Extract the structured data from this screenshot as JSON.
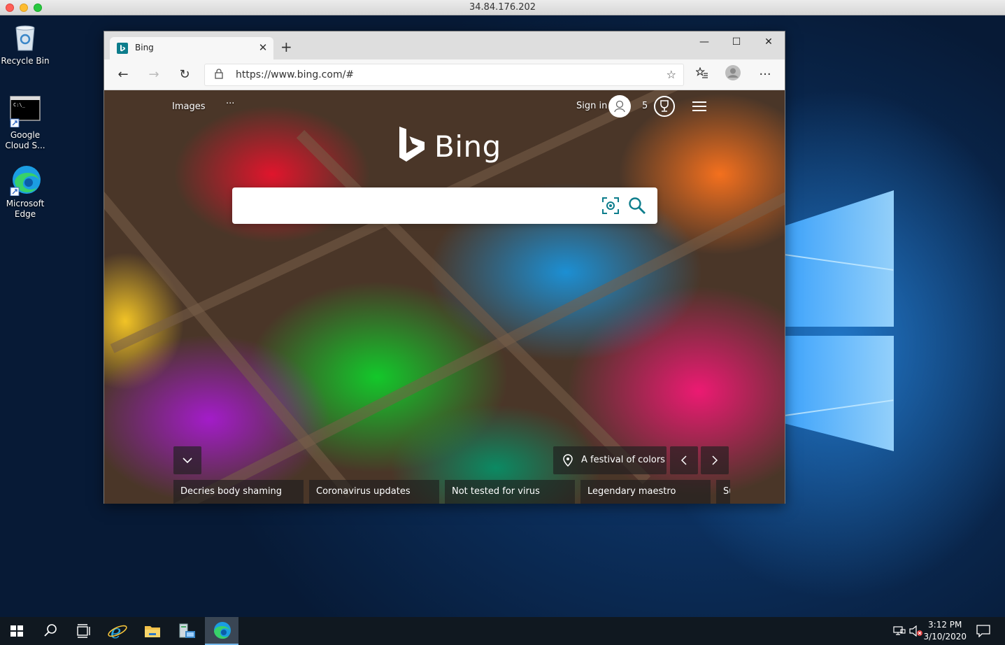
{
  "host": {
    "title": "34.84.176.202"
  },
  "desktop": {
    "icons": [
      {
        "label": "Recycle Bin",
        "icon": "recycle-bin-icon"
      },
      {
        "label": "Google Cloud S...",
        "icon": "terminal-shortcut-icon"
      },
      {
        "label": "Microsoft Edge",
        "icon": "edge-icon"
      }
    ]
  },
  "browser": {
    "tab": {
      "title": "Bing",
      "favicon": "bing-favicon-icon"
    },
    "new_tab": "+",
    "window_controls": {
      "minimize": "—",
      "maximize": "☐",
      "close": "✕"
    },
    "nav": {
      "back": "←",
      "forward": "→",
      "refresh": "↻",
      "more": "···"
    },
    "address": {
      "url": "https://www.bing.com/#"
    }
  },
  "bing": {
    "brand": "Bing",
    "nav_links": {
      "images": "Images",
      "more": "···"
    },
    "sign_in": "Sign in",
    "rewards_count": "5",
    "search": {
      "value": "",
      "placeholder": ""
    },
    "image_caption": "A festival of colors",
    "news": [
      "Decries body shaming",
      "Coronavirus updates",
      "Not tested for virus",
      "Legendary maestro",
      "Su"
    ],
    "colors": {
      "accent": "#0d7d8c"
    }
  },
  "taskbar": {
    "time": "3:12 PM",
    "date": "3/10/2020"
  }
}
